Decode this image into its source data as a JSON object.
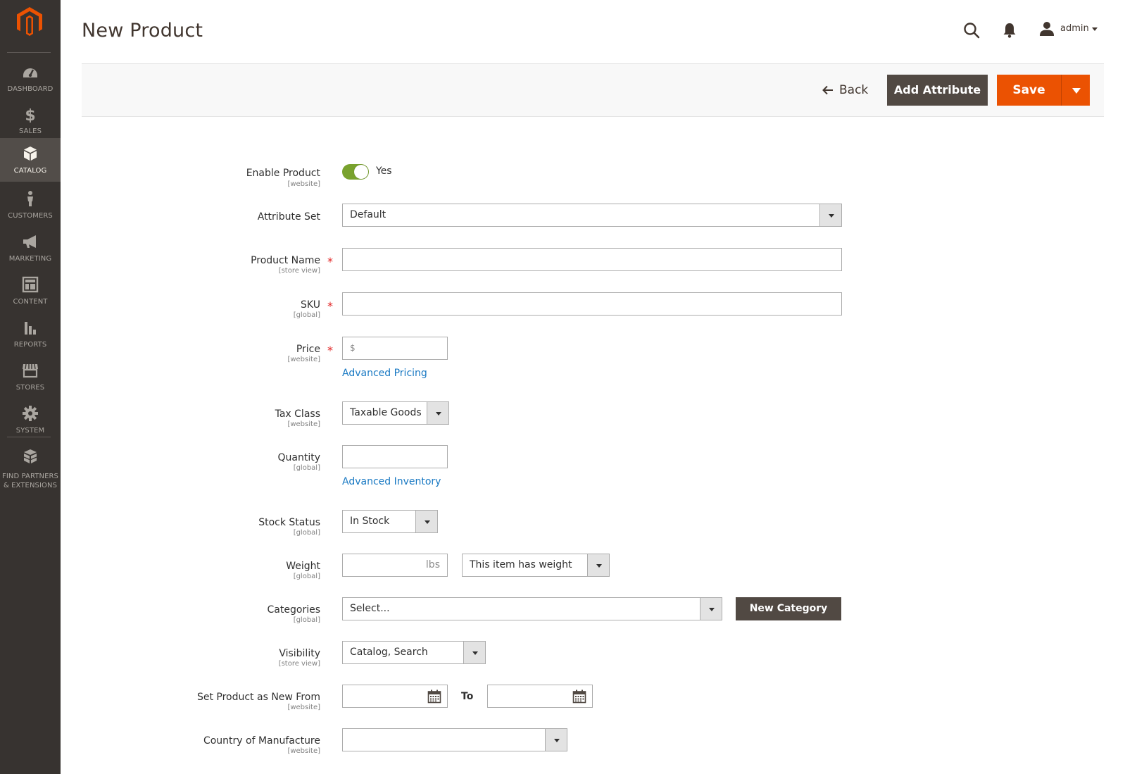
{
  "sidebar": {
    "logo": "magento-logo",
    "items": [
      {
        "label": "DASHBOARD",
        "icon": "dashboard-icon"
      },
      {
        "label": "SALES",
        "icon": "dollar-icon"
      },
      {
        "label": "CATALOG",
        "icon": "cube-icon",
        "active": true
      },
      {
        "label": "CUSTOMERS",
        "icon": "person-icon"
      },
      {
        "label": "MARKETING",
        "icon": "megaphone-icon"
      },
      {
        "label": "CONTENT",
        "icon": "layout-icon"
      },
      {
        "label": "REPORTS",
        "icon": "bar-chart-icon"
      },
      {
        "label": "STORES",
        "icon": "store-icon"
      },
      {
        "label": "SYSTEM",
        "icon": "gear-icon"
      },
      {
        "label": "FIND PARTNERS & EXTENSIONS",
        "icon": "blocks-icon"
      }
    ]
  },
  "header": {
    "title": "New Product",
    "username": "admin"
  },
  "actions": {
    "back": "Back",
    "add_attribute": "Add Attribute",
    "save": "Save"
  },
  "form": {
    "enable_product": {
      "label": "Enable Product",
      "scope": "[website]",
      "value": "Yes",
      "enabled": true
    },
    "attribute_set": {
      "label": "Attribute Set",
      "value": "Default"
    },
    "product_name": {
      "label": "Product Name",
      "scope": "[store view]",
      "value": "",
      "required": true
    },
    "sku": {
      "label": "SKU",
      "scope": "[global]",
      "value": "",
      "required": true
    },
    "price": {
      "label": "Price",
      "scope": "[website]",
      "currency": "$",
      "value": "",
      "required": true,
      "link": "Advanced Pricing"
    },
    "tax_class": {
      "label": "Tax Class",
      "scope": "[website]",
      "value": "Taxable Goods"
    },
    "quantity": {
      "label": "Quantity",
      "scope": "[global]",
      "value": "",
      "link": "Advanced Inventory"
    },
    "stock_status": {
      "label": "Stock Status",
      "scope": "[global]",
      "value": "In Stock"
    },
    "weight": {
      "label": "Weight",
      "scope": "[global]",
      "unit": "lbs",
      "value": "",
      "type_value": "This item has weight"
    },
    "categories": {
      "label": "Categories",
      "scope": "[global]",
      "placeholder": "Select...",
      "new_button": "New Category"
    },
    "visibility": {
      "label": "Visibility",
      "scope": "[store view]",
      "value": "Catalog, Search"
    },
    "new_from": {
      "label": "Set Product as New From",
      "scope": "[website]",
      "to_label": "To",
      "from_value": "",
      "to_value": ""
    },
    "country": {
      "label": "Country of Manufacture",
      "scope": "[website]",
      "value": ""
    }
  },
  "required_mark": "*",
  "colors": {
    "sidebar_bg": "#373330",
    "sidebar_active": "#524d49",
    "accent": "#eb5202",
    "dark_button": "#514943",
    "toggle_on": "#79a22e",
    "link": "#1979c3",
    "required": "#e22626"
  }
}
